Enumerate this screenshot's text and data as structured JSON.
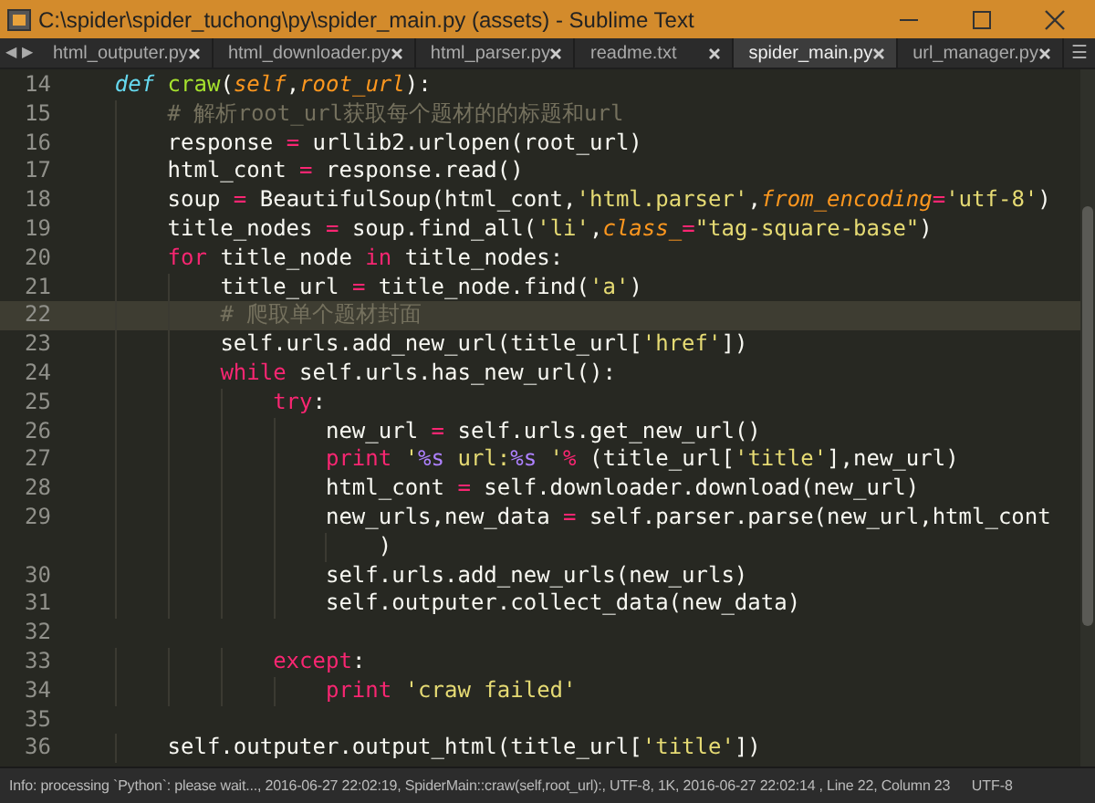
{
  "window": {
    "title": "C:\\spider\\spider_tuchong\\py\\spider_main.py (assets) - Sublime Text"
  },
  "tabs": [
    {
      "label": "html_outputer.py",
      "selected": false
    },
    {
      "label": "html_downloader.py",
      "selected": false
    },
    {
      "label": "html_parser.py",
      "selected": false
    },
    {
      "label": "readme.txt",
      "selected": false
    },
    {
      "label": "spider_main.py",
      "selected": true
    },
    {
      "label": "url_manager.py",
      "selected": false
    }
  ],
  "tab_nav": {
    "back": "◀",
    "forward": "▶",
    "menu": "☰"
  },
  "lines": [
    {
      "number": "14",
      "current": false,
      "tokens": [
        {
          "text": "    def",
          "kind": "def"
        },
        {
          "text": " craw",
          "kind": "func"
        },
        {
          "text": "(",
          "kind": "plain"
        },
        {
          "text": "self",
          "kind": "param"
        },
        {
          "text": ",",
          "kind": "plain"
        },
        {
          "text": "root_url",
          "kind": "param"
        },
        {
          "text": "):",
          "kind": "plain"
        }
      ]
    },
    {
      "number": "15",
      "current": false,
      "tokens": [
        {
          "text": "        # 解析root_url获取每个题材的的标题和url",
          "kind": "comment"
        }
      ]
    },
    {
      "number": "16",
      "current": false,
      "tokens": [
        {
          "text": "        response ",
          "kind": "plain"
        },
        {
          "text": "=",
          "kind": "op"
        },
        {
          "text": " urllib2.urlopen(root_url)",
          "kind": "plain"
        }
      ]
    },
    {
      "number": "17",
      "current": false,
      "tokens": [
        {
          "text": "        html_cont ",
          "kind": "plain"
        },
        {
          "text": "=",
          "kind": "op"
        },
        {
          "text": " response.read()",
          "kind": "plain"
        }
      ]
    },
    {
      "number": "18",
      "current": false,
      "tokens": [
        {
          "text": "        soup ",
          "kind": "plain"
        },
        {
          "text": "=",
          "kind": "op"
        },
        {
          "text": " BeautifulSoup(html_cont,",
          "kind": "plain"
        },
        {
          "text": "'html.parser'",
          "kind": "string"
        },
        {
          "text": ",",
          "kind": "plain"
        },
        {
          "text": "from_encoding",
          "kind": "param"
        },
        {
          "text": "=",
          "kind": "op"
        },
        {
          "text": "'utf-8'",
          "kind": "string"
        },
        {
          "text": ")",
          "kind": "plain"
        }
      ]
    },
    {
      "number": "19",
      "current": false,
      "tokens": [
        {
          "text": "        title_nodes ",
          "kind": "plain"
        },
        {
          "text": "=",
          "kind": "op"
        },
        {
          "text": " soup.find_all(",
          "kind": "plain"
        },
        {
          "text": "'li'",
          "kind": "string"
        },
        {
          "text": ",",
          "kind": "plain"
        },
        {
          "text": "class_",
          "kind": "param"
        },
        {
          "text": "=",
          "kind": "op"
        },
        {
          "text": "\"tag-square-base\"",
          "kind": "string"
        },
        {
          "text": ")",
          "kind": "plain"
        }
      ]
    },
    {
      "number": "20",
      "current": false,
      "tokens": [
        {
          "text": "        for",
          "kind": "keyword"
        },
        {
          "text": " title_node ",
          "kind": "plain"
        },
        {
          "text": "in",
          "kind": "keyword"
        },
        {
          "text": " title_nodes:",
          "kind": "plain"
        }
      ]
    },
    {
      "number": "21",
      "current": false,
      "tokens": [
        {
          "text": "            title_url ",
          "kind": "plain"
        },
        {
          "text": "=",
          "kind": "op"
        },
        {
          "text": " title_node.find(",
          "kind": "plain"
        },
        {
          "text": "'a'",
          "kind": "string"
        },
        {
          "text": ")",
          "kind": "plain"
        }
      ]
    },
    {
      "number": "22",
      "current": true,
      "tokens": [
        {
          "text": "            # 爬取单个题材封面",
          "kind": "comment"
        }
      ]
    },
    {
      "number": "23",
      "current": false,
      "tokens": [
        {
          "text": "            self.urls.add_new_url(title_url[",
          "kind": "plain"
        },
        {
          "text": "'href'",
          "kind": "string"
        },
        {
          "text": "])",
          "kind": "plain"
        }
      ]
    },
    {
      "number": "24",
      "current": false,
      "tokens": [
        {
          "text": "            while",
          "kind": "keyword"
        },
        {
          "text": " self.urls.has_new_url():",
          "kind": "plain"
        }
      ]
    },
    {
      "number": "25",
      "current": false,
      "tokens": [
        {
          "text": "                try",
          "kind": "keyword"
        },
        {
          "text": ":",
          "kind": "plain"
        }
      ]
    },
    {
      "number": "26",
      "current": false,
      "tokens": [
        {
          "text": "                    new_url ",
          "kind": "plain"
        },
        {
          "text": "=",
          "kind": "op"
        },
        {
          "text": " self.urls.get_new_url()",
          "kind": "plain"
        }
      ]
    },
    {
      "number": "27",
      "current": false,
      "tokens": [
        {
          "text": "                    print",
          "kind": "keyword"
        },
        {
          "text": " '",
          "kind": "string"
        },
        {
          "text": "%s",
          "kind": "format"
        },
        {
          "text": " url:",
          "kind": "string"
        },
        {
          "text": "%s",
          "kind": "format"
        },
        {
          "text": " '",
          "kind": "string"
        },
        {
          "text": "%",
          "kind": "op"
        },
        {
          "text": " (title_url[",
          "kind": "plain"
        },
        {
          "text": "'title'",
          "kind": "string"
        },
        {
          "text": "],new_url)",
          "kind": "plain"
        }
      ]
    },
    {
      "number": "28",
      "current": false,
      "tokens": [
        {
          "text": "                    html_cont ",
          "kind": "plain"
        },
        {
          "text": "=",
          "kind": "op"
        },
        {
          "text": " self.downloader.download(new_url)",
          "kind": "plain"
        }
      ]
    },
    {
      "number": "29",
      "current": false,
      "tokens": [
        {
          "text": "                    new_urls,new_data ",
          "kind": "plain"
        },
        {
          "text": "=",
          "kind": "op"
        },
        {
          "text": " self.parser.parse(new_url,html_cont",
          "kind": "plain"
        }
      ],
      "continuation": [
        {
          "text": "                        )",
          "kind": "plain"
        }
      ]
    },
    {
      "number": "30",
      "current": false,
      "tokens": [
        {
          "text": "                    self.urls.add_new_urls(new_urls)",
          "kind": "plain"
        }
      ]
    },
    {
      "number": "31",
      "current": false,
      "tokens": [
        {
          "text": "                    self.outputer.collect_data(new_data)",
          "kind": "plain"
        }
      ]
    },
    {
      "number": "32",
      "current": false
    },
    {
      "number": "33",
      "current": false,
      "tokens": [
        {
          "text": "                except",
          "kind": "keyword"
        },
        {
          "text": ":",
          "kind": "plain"
        }
      ]
    },
    {
      "number": "34",
      "current": false,
      "tokens": [
        {
          "text": "                    print",
          "kind": "keyword"
        },
        {
          "text": " 'craw failed'",
          "kind": "string"
        }
      ]
    },
    {
      "number": "35",
      "current": false
    },
    {
      "number": "36",
      "current": false,
      "tokens": [
        {
          "text": "        self.outputer.output_html(title_url[",
          "kind": "plain"
        },
        {
          "text": "'title'",
          "kind": "string"
        },
        {
          "text": "])",
          "kind": "plain"
        }
      ]
    }
  ],
  "status_bar": {
    "message": "Info: processing `Python`: please wait..., 2016-06-27 22:02:19, SpiderMain::craw(self,root_url):, UTF-8, 1K, 2016-06-27 22:02:14 , Line 22, Column 23",
    "encoding": "UTF-8"
  }
}
